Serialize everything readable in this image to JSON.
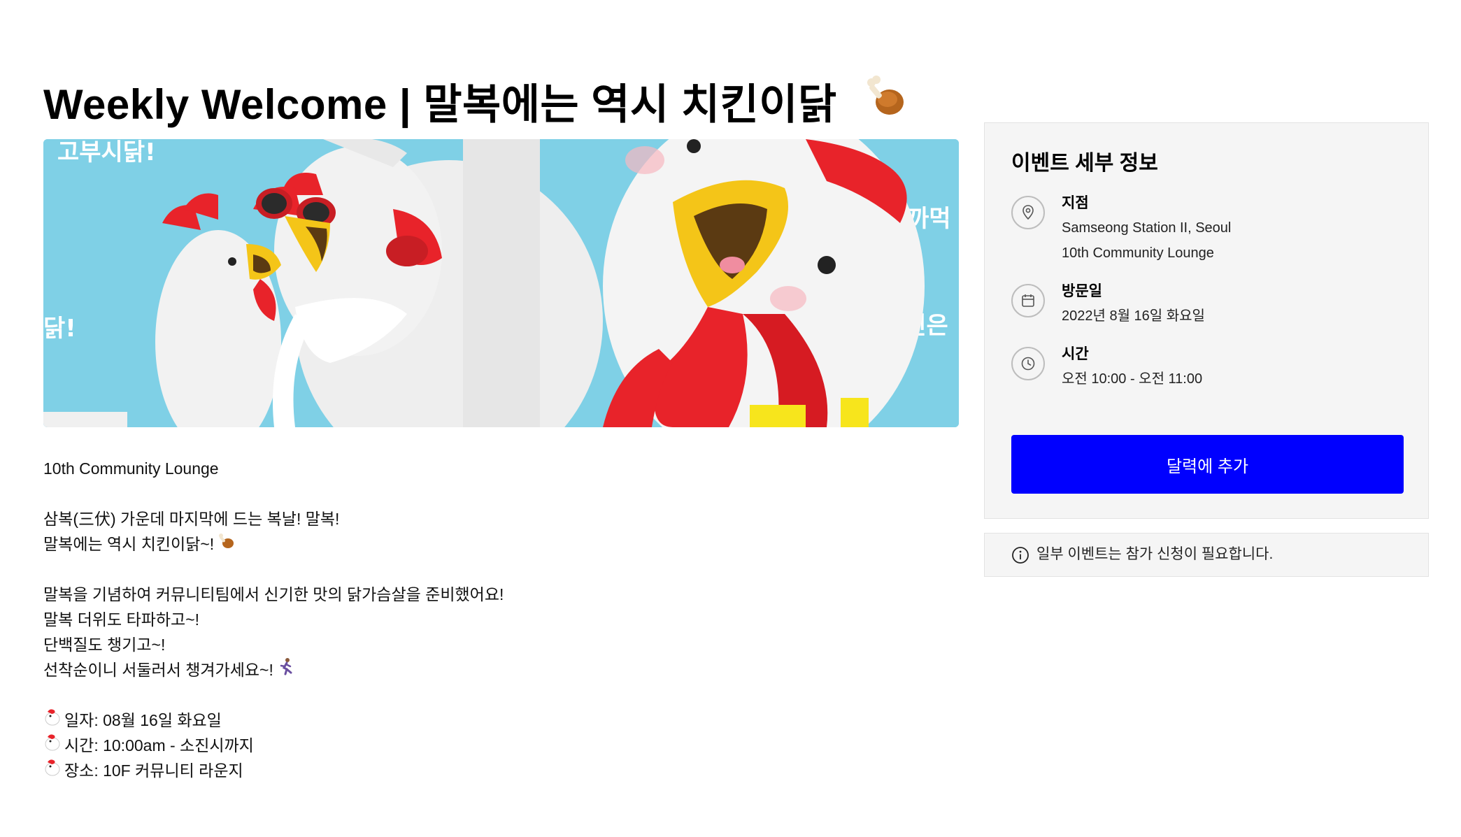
{
  "title": {
    "text": "Weekly Welcome | 말복에는 역시 치킨이닭",
    "emoji_icon": "drumstick-icon"
  },
  "hero": {
    "description": "chicken illustration banner",
    "label_text_1": "고부시닭!",
    "label_text_2": "까먹",
    "label_text_3": "닭!",
    "label_text_4": "치킨은"
  },
  "description": {
    "location_line": "10th Community Lounge",
    "para1_line1": "삼복(三伏) 가운데 마지막에 드는 복날! 말복!",
    "para1_line2": "말복에는 역시 치킨이닭~!",
    "para2_line1": "말복을 기념하여 커뮤니티팀에서 신기한 맛의 닭가슴살을 준비했어요!",
    "para2_line2": "말복 더위도 타파하고~!",
    "para2_line3": "단백질도 챙기고~!",
    "para2_line4": "선착순이니 서둘러서 챙겨가세요~!",
    "detail_date": "일자: 08월 16일 화요일",
    "detail_time": "시간: 10:00am - 소진시까지",
    "detail_place": "장소: 10F 커뮤니티 라운지"
  },
  "card": {
    "title": "이벤트 세부 정보",
    "location_label": "지점",
    "location_value_1": "Samseong Station II, Seoul",
    "location_value_2": "10th Community Lounge",
    "date_label": "방문일",
    "date_value": "2022년 8월 16일 화요일",
    "time_label": "시간",
    "time_value": "오전 10:00 - 오전 11:00",
    "button_label": "달력에 추가"
  },
  "notice": {
    "text": "일부 이벤트는 참가 신청이 필요합니다."
  },
  "colors": {
    "primary_button": "#0000ff",
    "card_background": "#f5f5f5",
    "hero_sky": "#7fd0e6",
    "chicken_red": "#e8232a",
    "beak_yellow": "#f4c518"
  }
}
